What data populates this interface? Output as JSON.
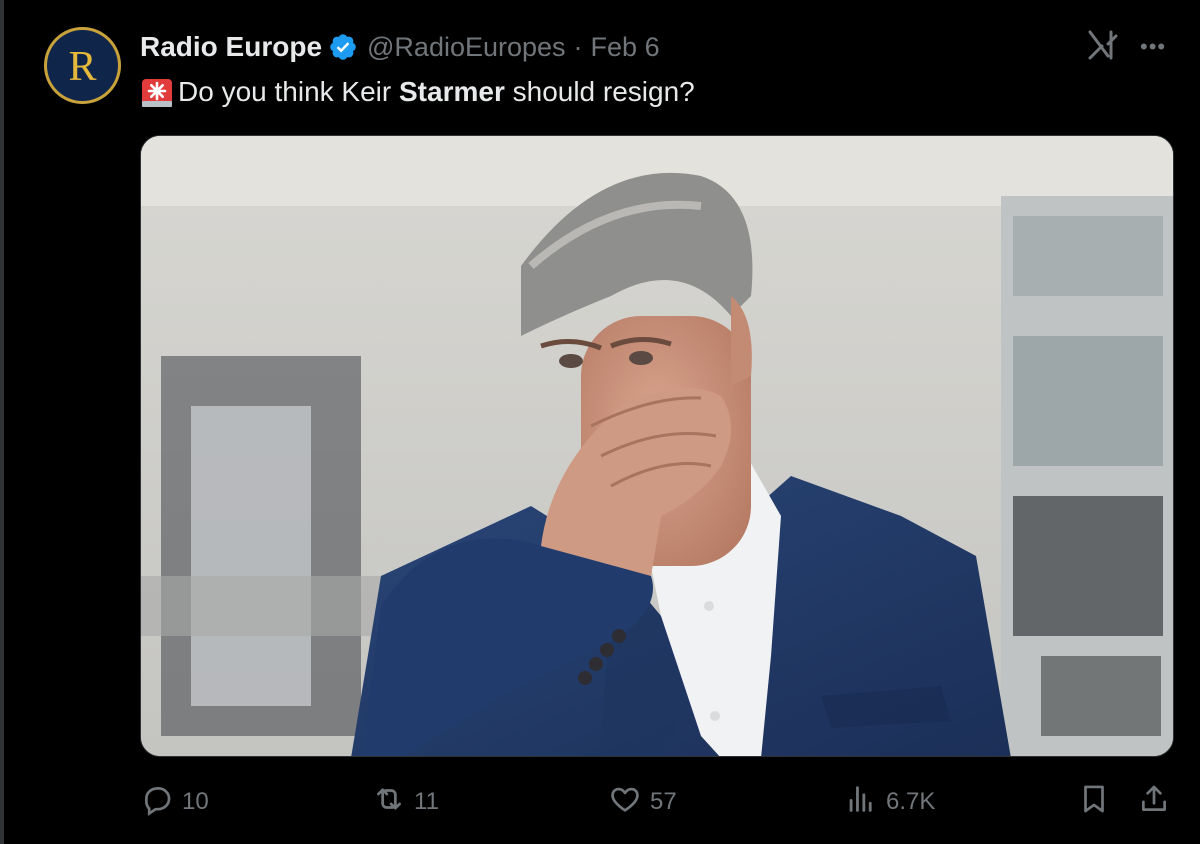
{
  "tweet": {
    "author": {
      "avatar_letter": "R",
      "display_name": "Radio Europe",
      "handle": "@RadioEuropes",
      "verified": true
    },
    "date": "Feb 6",
    "separator": "·",
    "text": {
      "emoji": "siren-emoji",
      "before": "Do you think Keir ",
      "bold": "Starmer",
      "after": " should resign?"
    },
    "media": {
      "type": "photo"
    },
    "actions": {
      "replies": "10",
      "reposts": "11",
      "likes": "57",
      "views": "6.7K"
    }
  },
  "icons": {
    "verified": "verified-badge-icon",
    "grok": "grok-icon",
    "more": "more-options-icon",
    "reply": "reply-icon",
    "repost": "repost-icon",
    "like": "heart-icon",
    "views": "views-bars-icon",
    "bookmark": "bookmark-icon",
    "share": "share-icon"
  },
  "colors": {
    "background": "#000000",
    "text_primary": "#e7e9ea",
    "text_secondary": "#71767b",
    "verified_blue": "#1d9bf0",
    "avatar_bg": "#10254a",
    "avatar_gold": "#e4b93c"
  }
}
